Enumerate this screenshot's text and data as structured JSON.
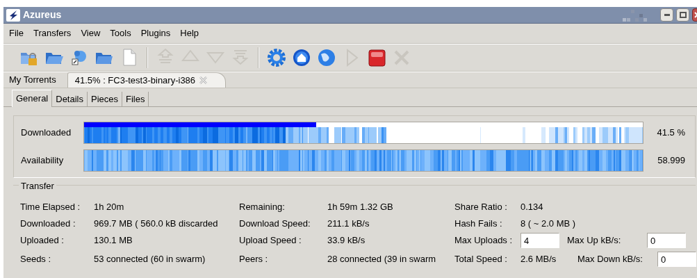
{
  "window": {
    "title": "Azureus"
  },
  "menu": [
    "File",
    "Transfers",
    "View",
    "Tools",
    "Plugins",
    "Help"
  ],
  "toolbar": [
    {
      "kind": "lock-folder"
    },
    {
      "kind": "folder-open"
    },
    {
      "kind": "globe-link"
    },
    {
      "kind": "folder"
    },
    {
      "kind": "document"
    },
    {
      "kind": "separator"
    },
    {
      "kind": "top"
    },
    {
      "kind": "up"
    },
    {
      "kind": "down"
    },
    {
      "kind": "bottom"
    },
    {
      "kind": "separator"
    },
    {
      "kind": "gear"
    },
    {
      "kind": "home"
    },
    {
      "kind": "globe"
    },
    {
      "kind": "play"
    },
    {
      "kind": "stop"
    },
    {
      "kind": "remove"
    }
  ],
  "tabs": [
    {
      "label": "My Torrents",
      "selected": false,
      "closable": false
    },
    {
      "label": "41.5% : FC3-test3-binary-i386",
      "selected": true,
      "closable": true
    }
  ],
  "subtabs": [
    {
      "label": "General",
      "selected": true
    },
    {
      "label": "Details",
      "selected": false
    },
    {
      "label": "Pieces",
      "selected": false
    },
    {
      "label": "Files",
      "selected": false
    }
  ],
  "bars": [
    {
      "label": "Downloaded",
      "kind": "progress",
      "level": 0.415,
      "value": "41.5 %"
    },
    {
      "label": "Availability",
      "kind": "availability",
      "value": "58.999"
    }
  ],
  "transfer": {
    "title": "Transfer",
    "rows": [
      {
        "cells": [
          {
            "label": "Time Elapsed :",
            "value": "1h 20m"
          },
          {
            "label": "Remaining:",
            "value": "1h 59m 1.32 GB"
          },
          {
            "label": "Share Ratio :",
            "value": "0.134"
          }
        ]
      },
      {
        "cells": [
          {
            "label": "Downloaded :",
            "value": "969.7 MB ( 560.0 kB discarded"
          },
          {
            "label": "Download Speed:",
            "value": "211.1 kB/s"
          },
          {
            "label": "Hash Fails :",
            "value": "8 ( ~ 2.0 MB )"
          }
        ]
      },
      {
        "cells": [
          {
            "label": "Uploaded :",
            "value": "130.1 MB"
          },
          {
            "label": "Upload Speed :",
            "value": "33.9 kB/s"
          },
          {
            "label": "Max Uploads :",
            "field": "4"
          },
          {
            "label": "Max Up kB/s:",
            "field": "0"
          }
        ]
      },
      {
        "cells": [
          {
            "label": "Seeds :",
            "value": "53 connected (60 in swarm)"
          },
          {
            "label": "Peers :",
            "value": "28 connected (39 in swarm"
          },
          {
            "label": "Total Speed :",
            "value": "2.6 MB/s"
          },
          {
            "label": "Max Down kB/s:",
            "field": "0"
          }
        ]
      }
    ]
  }
}
